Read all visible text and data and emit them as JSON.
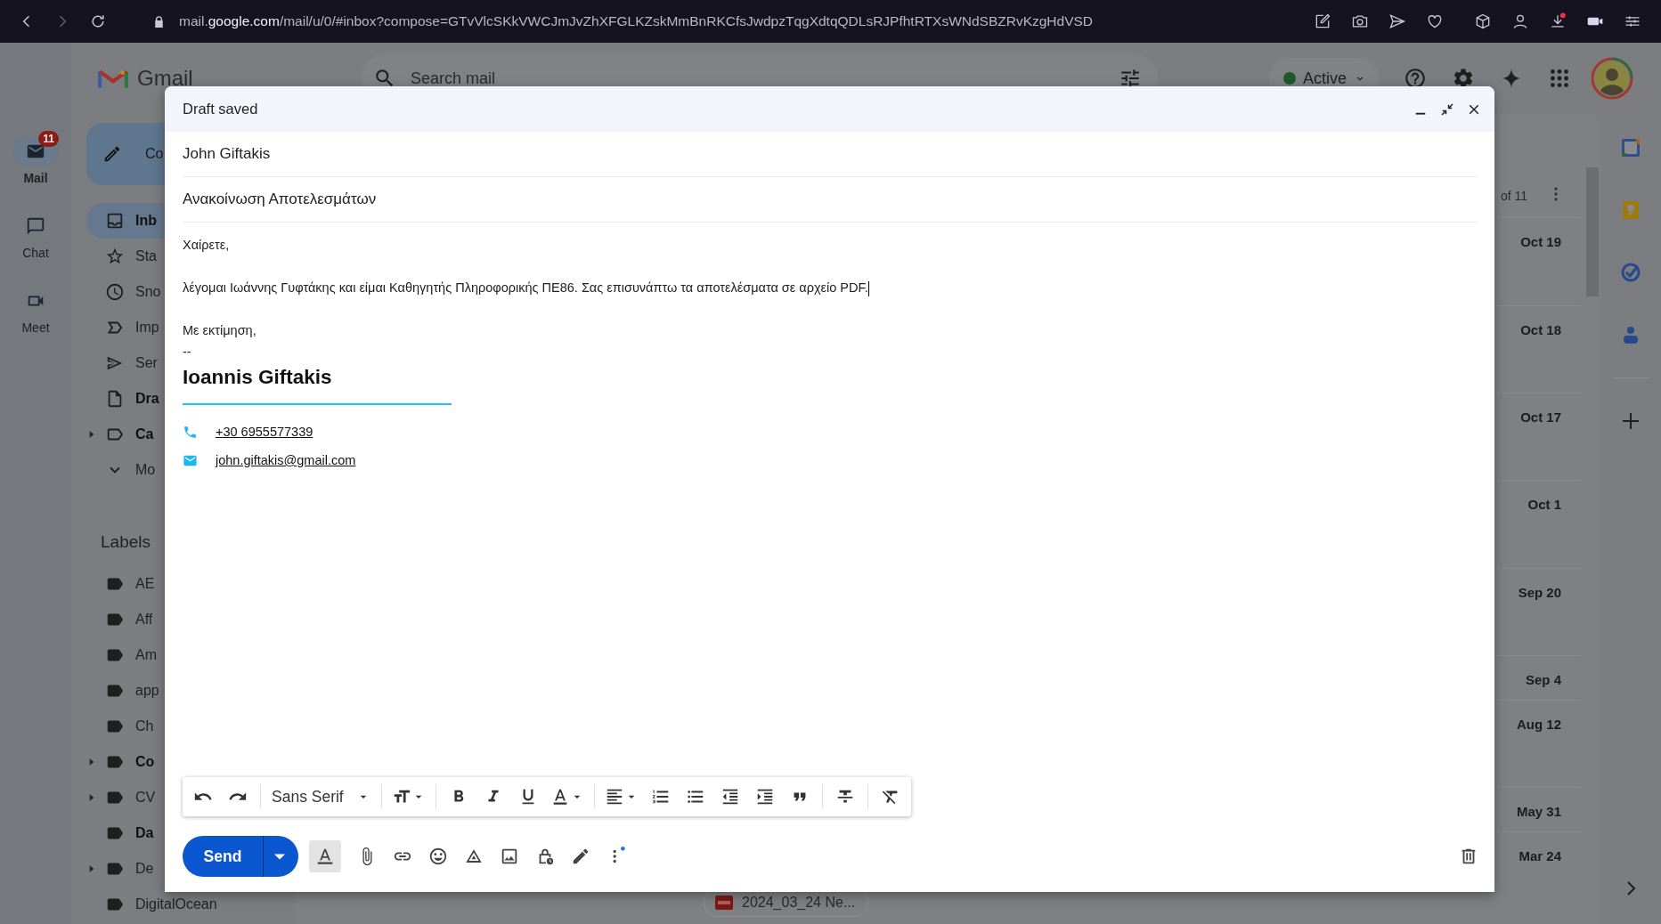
{
  "browser": {
    "url": {
      "subdomain": "mail.",
      "domain": "google.com",
      "path": "/mail/u/0/#inbox?compose=GTvVlcSKkVWCJmJvZhXFGLKZskMmBnRKCfsJwdpzTqgXdtqQDLsRJPfhtRTXsWNdSBZRvKzgHdVSD"
    },
    "download_alert": true
  },
  "gmail": {
    "logo": "Gmail",
    "search": {
      "placeholder": "Search mail"
    },
    "status": "Active",
    "rail": [
      {
        "label": "Mail",
        "kind": "mail",
        "selected": true,
        "badge": "11"
      },
      {
        "label": "Chat",
        "kind": "chat",
        "selected": false
      },
      {
        "label": "Meet",
        "kind": "meet",
        "selected": false
      }
    ],
    "compose_button": "Co",
    "nav": [
      {
        "label": "Inb",
        "kind": "inbox",
        "unread": true,
        "selected": true,
        "expandable": false
      },
      {
        "label": "Sta",
        "kind": "star",
        "unread": false,
        "selected": false,
        "expandable": false
      },
      {
        "label": "Sno",
        "kind": "clock",
        "unread": false,
        "selected": false,
        "expandable": false
      },
      {
        "label": "Imp",
        "kind": "important",
        "unread": false,
        "selected": false,
        "expandable": false
      },
      {
        "label": "Ser",
        "kind": "send",
        "unread": false,
        "selected": false,
        "expandable": false
      },
      {
        "label": "Dra",
        "kind": "file",
        "unread": true,
        "selected": false,
        "expandable": false
      },
      {
        "label": "Ca",
        "kind": "category",
        "unread": true,
        "selected": false,
        "expandable": true
      },
      {
        "label": "Mo",
        "kind": "more",
        "unread": false,
        "selected": false,
        "expandable": false
      }
    ],
    "labels_heading": "Labels",
    "labels": [
      {
        "label": "AE",
        "unread": false,
        "expandable": false
      },
      {
        "label": "Aff",
        "unread": false,
        "expandable": false
      },
      {
        "label": "Am",
        "unread": false,
        "expandable": false
      },
      {
        "label": "app",
        "unread": false,
        "expandable": false
      },
      {
        "label": "Ch",
        "unread": false,
        "expandable": false
      },
      {
        "label": "Co",
        "unread": true,
        "expandable": true
      },
      {
        "label": "CV",
        "unread": false,
        "expandable": true
      },
      {
        "label": "Da",
        "unread": true,
        "expandable": false
      },
      {
        "label": "De",
        "unread": false,
        "expandable": true
      },
      {
        "label": "DigitalOcean",
        "unread": false,
        "expandable": false
      }
    ],
    "list": {
      "pagination": "of 11",
      "rows": [
        {
          "date": "Oct 19"
        },
        {
          "date": "Oct 18"
        },
        {
          "date": "Oct 17"
        },
        {
          "date": "Oct 1"
        },
        {
          "date": "Sep 20"
        },
        {
          "date": "Sep 4"
        },
        {
          "date": "Aug 12"
        },
        {
          "date": "May 31"
        },
        {
          "date": "Mar 24",
          "attachment": "2024_03_24 Ne..."
        }
      ]
    }
  },
  "compose": {
    "title": "Draft saved",
    "to": "John Giftakis",
    "subject": "Ανακοίνωση Αποτελεσμάτων",
    "body": [
      "Χαίρετε,",
      "λέγομαι Ιωάννης Γυφτάκης και είμαι Καθηγητής Πληροφορικής ΠΕ86. Σας επισυνάπτω τα αποτελέσματα σε αρχείο PDF.",
      "Με εκτίμηση,"
    ],
    "signature": {
      "separator": "--",
      "name": "Ioannis Giftakis",
      "phone": "+30 6955577339",
      "email": "john.giftakis@gmail.com"
    },
    "font": "Sans Serif",
    "send": "Send",
    "formatting_selected": true,
    "more_options_alert": true
  }
}
